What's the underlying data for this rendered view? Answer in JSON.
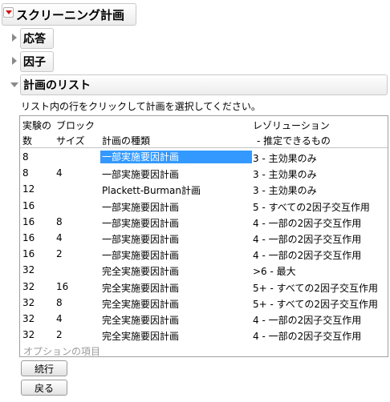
{
  "title": "スクリーニング計画",
  "sections": {
    "response": "応答",
    "factors": "因子",
    "design_list": "計画のリスト"
  },
  "instruction": "リスト内の行をクリックして計画を選択してください。",
  "table": {
    "headers": {
      "runs_line1": "実験の",
      "runs_line2": "数",
      "block_line1": "ブロック",
      "block_line2": "サイズ",
      "type": "計画の種類",
      "resolution_line1": "レゾリューション",
      "resolution_line2": "- 推定できるもの"
    },
    "rows": [
      {
        "runs": "8",
        "block": "",
        "type": "一部実施要因計画",
        "resolution": "3 - 主効果のみ",
        "selected": true
      },
      {
        "runs": "8",
        "block": "4",
        "type": "一部実施要因計画",
        "resolution": "3 - 主効果のみ"
      },
      {
        "runs": "12",
        "block": "",
        "type": "Plackett-Burman計画",
        "resolution": "3 - 主効果のみ"
      },
      {
        "runs": "16",
        "block": "",
        "type": "一部実施要因計画",
        "resolution": "5 - すべての2因子交互作用"
      },
      {
        "runs": "16",
        "block": "8",
        "type": "一部実施要因計画",
        "resolution": "4 - 一部の2因子交互作用"
      },
      {
        "runs": "16",
        "block": "4",
        "type": "一部実施要因計画",
        "resolution": "4 - 一部の2因子交互作用"
      },
      {
        "runs": "16",
        "block": "2",
        "type": "一部実施要因計画",
        "resolution": "4 - 一部の2因子交互作用"
      },
      {
        "runs": "32",
        "block": "",
        "type": "完全実施要因計画",
        "resolution": ">6 - 最大"
      },
      {
        "runs": "32",
        "block": "16",
        "type": "完全実施要因計画",
        "resolution": "5+ - すべての2因子交互作用"
      },
      {
        "runs": "32",
        "block": "8",
        "type": "完全実施要因計画",
        "resolution": "5+ - すべての2因子交互作用"
      },
      {
        "runs": "32",
        "block": "4",
        "type": "完全実施要因計画",
        "resolution": "4 - 一部の2因子交互作用"
      },
      {
        "runs": "32",
        "block": "2",
        "type": "完全実施要因計画",
        "resolution": "4 - 一部の2因子交互作用"
      }
    ],
    "options_label": "オプションの項目"
  },
  "buttons": {
    "continue": "続行",
    "back": "戻る"
  },
  "colors": {
    "selection": "#3399ff",
    "menu_arrow": "#d41414"
  }
}
